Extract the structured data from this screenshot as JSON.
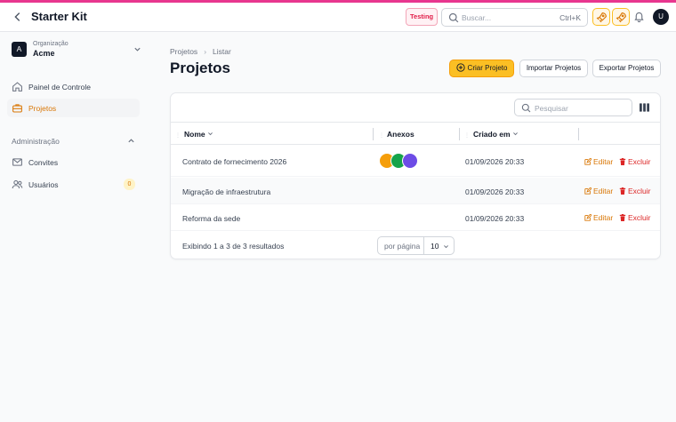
{
  "header": {
    "app_title": "Starter Kit",
    "env_badge": "Testing",
    "search_placeholder": "Buscar...",
    "search_shortcut": "Ctrl+K",
    "avatar_initial": "U"
  },
  "sidebar": {
    "org": {
      "avatar_initial": "A",
      "label": "Organização",
      "name": "Acme"
    },
    "items": [
      {
        "label": "Painel de Controle",
        "icon": "home-icon",
        "active": false
      },
      {
        "label": "Projetos",
        "icon": "briefcase-icon",
        "active": true
      }
    ],
    "group": {
      "label": "Administração",
      "items": [
        {
          "label": "Convites",
          "icon": "mail-icon"
        },
        {
          "label": "Usuários",
          "icon": "users-icon",
          "badge": "0"
        }
      ]
    }
  },
  "main": {
    "breadcrumb": [
      "Projetos",
      "Listar"
    ],
    "title": "Projetos",
    "actions": {
      "create": "Criar Projeto",
      "import": "Importar Projetos",
      "export": "Exportar Projetos"
    },
    "table": {
      "search_placeholder": "Pesquisar",
      "columns": [
        "Nome",
        "Anexos",
        "Criado em"
      ],
      "rows": [
        {
          "name": "Contrato de fornecimento 2026",
          "created": "01/09/2026 20:33",
          "attachments": [
            "#f59e0b",
            "#16a34a",
            "#6d4ce6"
          ]
        },
        {
          "name": "Migração de infraestrutura",
          "created": "01/09/2026 20:33",
          "attachments": []
        },
        {
          "name": "Reforma da sede",
          "created": "01/09/2026 20:33",
          "attachments": []
        }
      ],
      "edit_label": "Editar",
      "delete_label": "Excluir",
      "footer": "Exibindo 1 a 3 de 3 resultados",
      "per_page_label": "por página",
      "per_page_value": "10"
    }
  },
  "colors": {
    "accent": "#fbbf24",
    "brand_strip": "#e8368f",
    "danger": "#dc2626"
  }
}
